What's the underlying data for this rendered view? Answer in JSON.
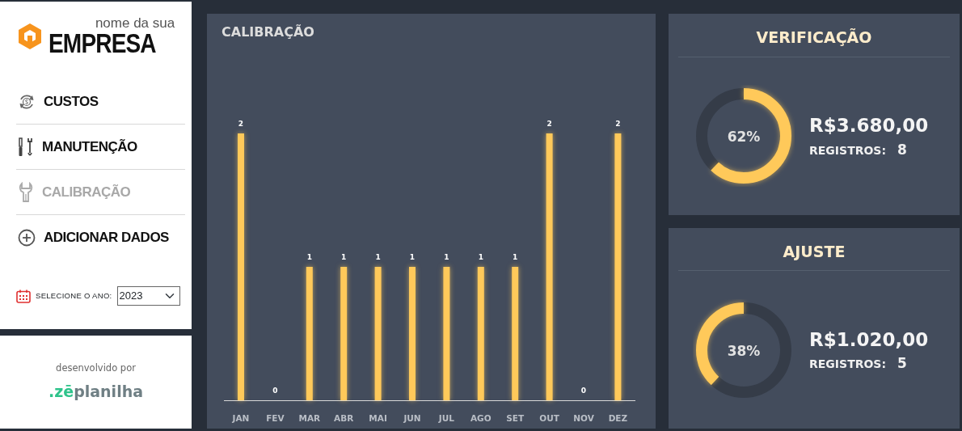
{
  "logo": {
    "tagline": "nome da sua",
    "name": "EMPRESA"
  },
  "menu": [
    {
      "label": "CUSTOS",
      "selected": false
    },
    {
      "label": "MANUTENÇÃO",
      "selected": false
    },
    {
      "label": "CALIBRAÇÃO",
      "selected": true
    },
    {
      "label": "ADICIONAR DADOS",
      "selected": false
    }
  ],
  "year_filter": {
    "label": "SELECIONE O ANO:",
    "value": "2023"
  },
  "credits": {
    "caption": "desenvolvido por",
    "brand_prefix": ".zē",
    "brand_name": "planilha"
  },
  "chart_panel": {
    "title": "CALIBRAÇÃO",
    "chart_data": {
      "type": "bar",
      "categories": [
        "JAN",
        "FEV",
        "MAR",
        "ABR",
        "MAI",
        "JUN",
        "JUL",
        "AGO",
        "SET",
        "OUT",
        "NOV",
        "DEZ"
      ],
      "series": [
        {
          "color": "#ffc95a",
          "values": [
            2,
            0,
            1,
            1,
            1,
            1,
            1,
            1,
            1,
            2,
            0,
            2
          ]
        }
      ],
      "data_labels": true
    }
  },
  "cards": [
    {
      "title": "VERIFICAÇÃO",
      "percent": "62%",
      "amount": "R$3.680,00",
      "records_label": "REGISTROS:",
      "records": "8"
    },
    {
      "title": "AJUSTE",
      "percent": "38%",
      "amount": "R$1.020,00",
      "records_label": "REGISTROS:",
      "records": "5"
    }
  ]
}
